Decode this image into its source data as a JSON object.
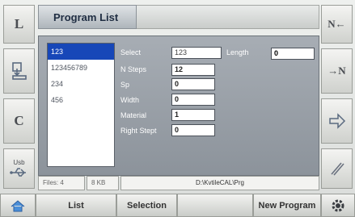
{
  "title": "Program List",
  "left_buttons": [
    "L",
    "C"
  ],
  "usb_label": "Usb",
  "programs": [
    "123",
    "123456789",
    "234",
    "456"
  ],
  "selected_program": "123",
  "fields": {
    "select_label": "Select",
    "select_value": "123",
    "length_label": "Length",
    "length_value": "0",
    "nsteps_label": "N Steps",
    "nsteps_value": "12",
    "sp_label": "Sp",
    "sp_value": "0",
    "width_label": "Width",
    "width_value": "0",
    "material_label": "Material",
    "material_value": "1",
    "rightstept_label": "Right Stept",
    "rightstept_value": "0"
  },
  "status": {
    "files": "Files: 4",
    "size": "8 KB",
    "path": "D:\\KvtileCAL\\Prg"
  },
  "bottom": {
    "list": "List",
    "selection": "Selection",
    "new_program": "New Program"
  },
  "right_buttons": [
    "N←",
    "→N"
  ]
}
